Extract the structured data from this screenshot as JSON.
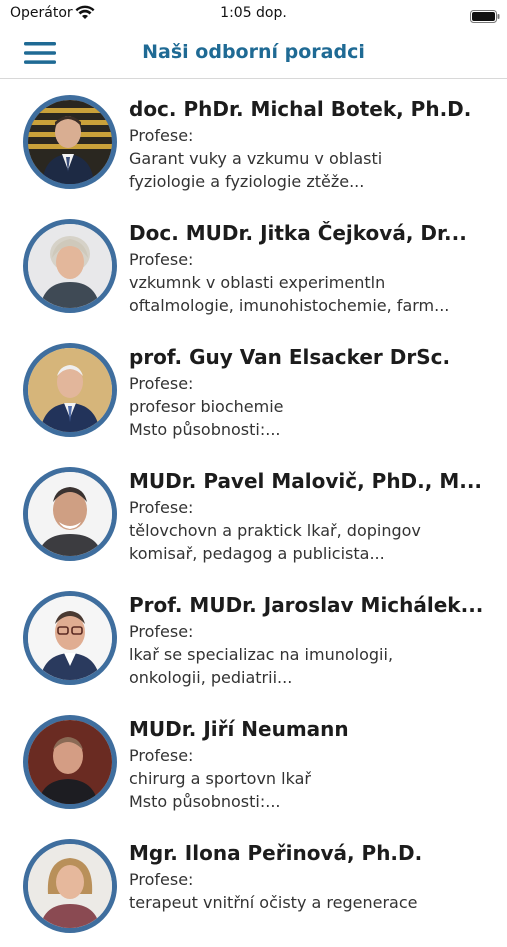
{
  "status_bar": {
    "carrier": "Operátor",
    "time": "1:05 dop.",
    "icons": [
      "wifi-icon",
      "battery-icon"
    ]
  },
  "nav": {
    "title": "Naši odborní poradci",
    "menu_icon": "hamburger-menu-icon",
    "accent_color": "#1f6a94"
  },
  "advisors": [
    {
      "name": "doc. PhDr. Michal Botek, Ph.D.",
      "line1": "Profese:",
      "line2": "Garant vuky a vzkumu v oblasti",
      "line3": "fyziologie a fyziologie ztěže..."
    },
    {
      "name": "Doc. MUDr. Jitka Čejková, Dr...",
      "line1": "Profese:",
      "line2": "vzkumnk v oblasti experimentln",
      "line3": "oftalmologie, imunohistochemie, farm..."
    },
    {
      "name": "prof. Guy Van Elsacker DrSc.",
      "line1": "Profese:",
      "line2": "profesor biochemie",
      "line3": "Msto působnosti:..."
    },
    {
      "name": "MUDr. Pavel Malovič, PhD., M...",
      "line1": "Profese:",
      "line2": "tělovchovn a praktick lkař, dopingov",
      "line3": "komisař, pedagog a publicista..."
    },
    {
      "name": "Prof. MUDr. Jaroslav Michálek...",
      "line1": "Profese:",
      "line2": "lkař se specializac na imunologii,",
      "line3": "onkologii, pediatrii..."
    },
    {
      "name": "MUDr. Jiří Neumann",
      "line1": "Profese:",
      "line2": "chirurg a sportovn lkař",
      "line3": "Msto působnosti:..."
    },
    {
      "name": "Mgr. Ilona Peřinová, Ph.D.",
      "line1": "Profese:",
      "line2": "terapeut vnitřní očisty a regenerace",
      "line3": ""
    }
  ]
}
